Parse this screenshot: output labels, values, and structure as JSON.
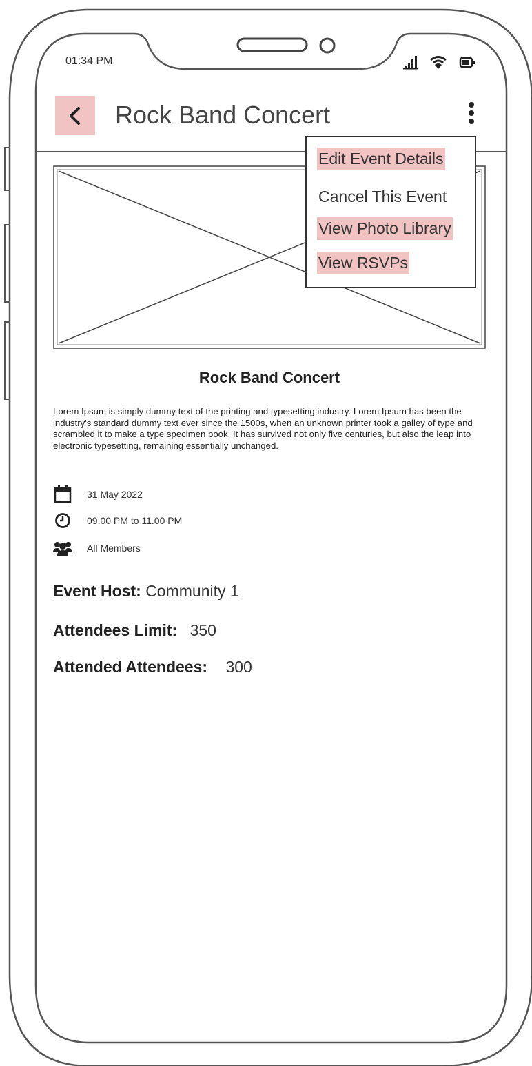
{
  "status_bar": {
    "time": "01:34 PM",
    "icons": [
      "signal-icon",
      "wifi-icon",
      "battery-icon"
    ]
  },
  "header": {
    "back_icon": "chevron-left-icon",
    "title": "Rock Band Concert",
    "menu_icon": "kebab-menu-icon"
  },
  "menu": {
    "items": [
      {
        "label": "Edit Event Details",
        "highlighted": true
      },
      {
        "label": "Cancel This Event",
        "highlighted": false
      },
      {
        "label": "View Photo Library",
        "highlighted": true
      },
      {
        "label": "View RSVPs",
        "highlighted": true
      }
    ]
  },
  "event": {
    "title": "Rock Band Concert",
    "description": "Lorem Ipsum is simply dummy text of the printing and typesetting industry. Lorem Ipsum has been the industry's standard dummy text ever since the 1500s, when an unknown printer took a galley of type and scrambled it to make a type specimen book. It has survived not only five centuries, but also the leap into electronic typesetting, remaining essentially unchanged.",
    "date": "31 May 2022",
    "time": "09.00 PM to 11.00 PM",
    "audience": "All Members",
    "host_label": "Event Host:",
    "host_value": "Community 1",
    "limit_label": "Attendees Limit:",
    "limit_value": "350",
    "attended_label": "Attended Attendees:",
    "attended_value": "300"
  },
  "colors": {
    "highlight": "#f1c3c3",
    "outline": "#555555",
    "text": "#333333"
  }
}
